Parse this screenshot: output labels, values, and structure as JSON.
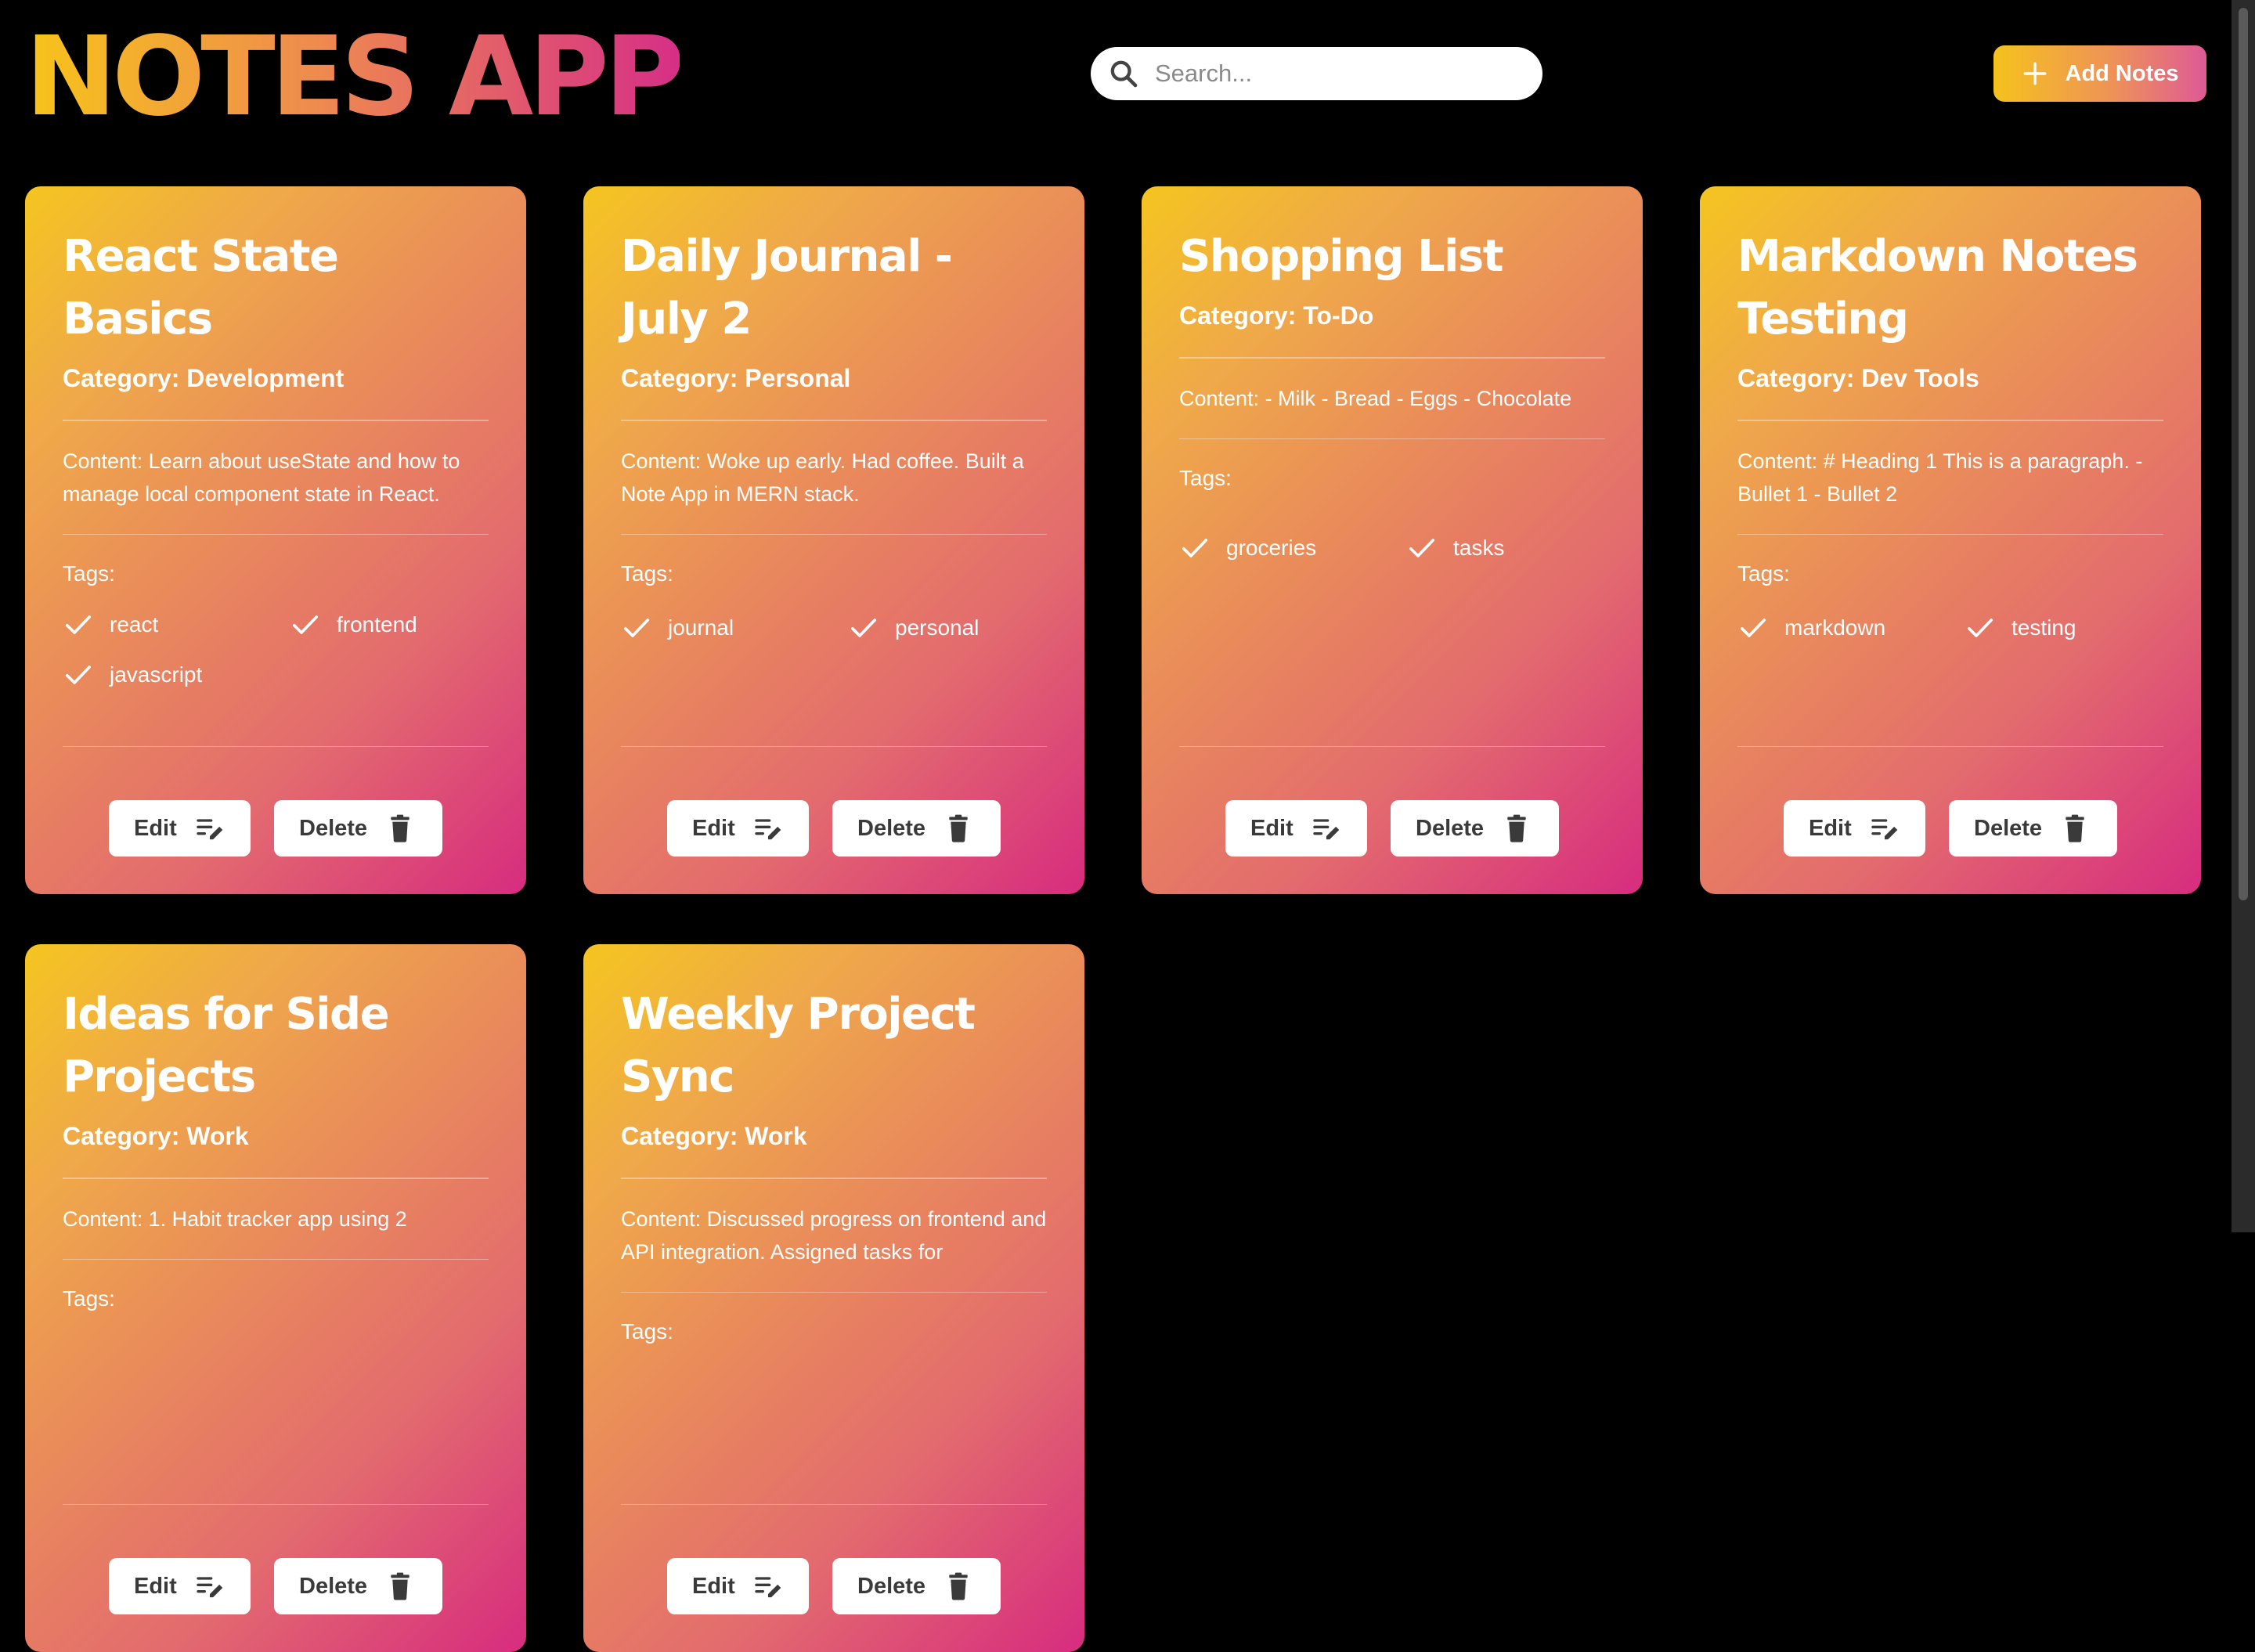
{
  "header": {
    "title": "NOTES APP",
    "search_placeholder": "Search...",
    "add_button_label": "Add Notes"
  },
  "colors": {
    "background": "#000000",
    "gradient_start": "#f5c520",
    "gradient_end": "#d72c7f",
    "button_text": "#3a3a3a"
  },
  "icons": {
    "search": "search-icon",
    "add": "plus-icon",
    "tag": "check-icon",
    "edit": "edit-note-icon",
    "delete": "trash-icon"
  },
  "notes": [
    {
      "title": "React State Basics",
      "category": "Category: Development",
      "content": "Content: Learn about useState and how to manage local component state in React.",
      "tags_label": "Tags:",
      "tags": [
        "react",
        "frontend",
        "javascript"
      ],
      "edit_label": "Edit",
      "delete_label": "Delete"
    },
    {
      "title": "Daily Journal - July 2",
      "category": "Category: Personal",
      "content": "Content: Woke up early. Had coffee. Built a Note App in MERN stack.",
      "tags_label": "Tags:",
      "tags": [
        "journal",
        "personal"
      ],
      "edit_label": "Edit",
      "delete_label": "Delete"
    },
    {
      "title": "Shopping List",
      "category": "Category: To-Do",
      "content": "Content: - Milk - Bread - Eggs - Chocolate",
      "tags_label": "Tags:",
      "tags": [
        "groceries",
        "tasks"
      ],
      "edit_label": "Edit",
      "delete_label": "Delete"
    },
    {
      "title": "Markdown Notes Testing",
      "category": "Category: Dev Tools",
      "content": "Content: # Heading 1 This is a paragraph. - Bullet 1 - Bullet 2",
      "tags_label": "Tags:",
      "tags": [
        "markdown",
        "testing"
      ],
      "edit_label": "Edit",
      "delete_label": "Delete"
    },
    {
      "title": "Ideas for Side Projects",
      "category": "Category: Work",
      "content": "Content: 1. Habit tracker app using 2",
      "tags_label": "Tags:",
      "tags": [],
      "edit_label": "Edit",
      "delete_label": "Delete"
    },
    {
      "title": "Weekly Project Sync",
      "category": "Category: Work",
      "content": "Content: Discussed progress on frontend and API integration. Assigned tasks for",
      "tags_label": "Tags:",
      "tags": [],
      "edit_label": "Edit",
      "delete_label": "Delete"
    }
  ]
}
